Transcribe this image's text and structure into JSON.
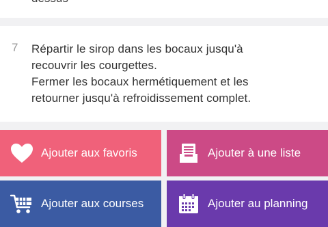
{
  "previous_step": {
    "text": "dessus"
  },
  "step": {
    "number": "7",
    "text": "Répartir le sirop dans les bocaux jusqu'à\nrecouvrir les courgettes.\nFermer les bocaux hermétiquement et les\nretourner jusqu'à refroidissement complet."
  },
  "actions": {
    "favorites": {
      "label": "Ajouter aux favoris",
      "icon": "heart-icon",
      "color": "#f0617a"
    },
    "list": {
      "label": "Ajouter à une liste",
      "icon": "list-tray-icon",
      "color": "#cc4a86"
    },
    "shopping": {
      "label": "Ajouter aux courses",
      "icon": "cart-icon",
      "color": "#3b5ba3"
    },
    "planning": {
      "label": "Ajouter au planning",
      "icon": "calendar-icon",
      "color": "#6a3aac"
    }
  }
}
